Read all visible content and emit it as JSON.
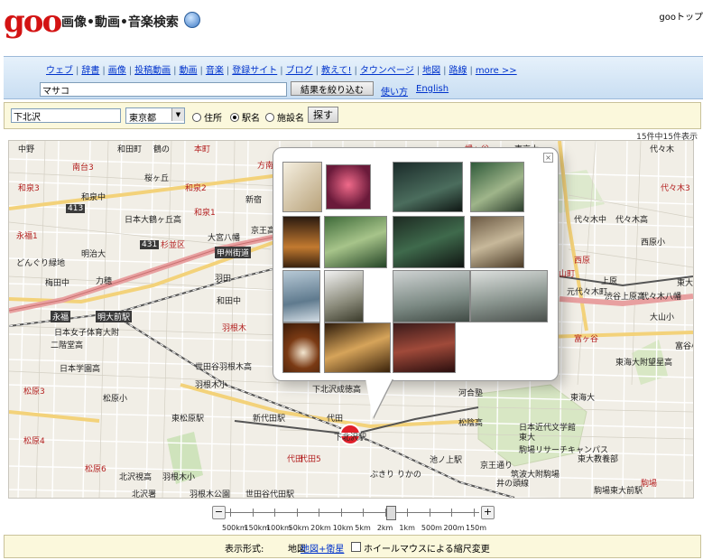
{
  "header": {
    "logo": "goo",
    "site_name": "画像•動画•音楽検索",
    "top_link": "gooトップ"
  },
  "search": {
    "tabs": [
      "ウェブ",
      "辞書",
      "画像",
      "投稿動画",
      "動画",
      "音楽",
      "登録サイト",
      "ブログ",
      "教えて!",
      "タウンページ",
      "地図",
      "路線",
      "more >>"
    ],
    "query": "マサコ",
    "narrow_button": "結果を絞り込む",
    "help_link": "使い方",
    "english_link": "English"
  },
  "station_search": {
    "keyword": "下北沢",
    "prefecture": "東京都",
    "options": [
      "住所",
      "駅名",
      "施設名"
    ],
    "selected_option": "駅名",
    "find_button": "探す"
  },
  "result_count": "15件中15件表示",
  "map": {
    "labels": [
      {
        "t": "中野",
        "c": ""
      },
      {
        "t": "和田町",
        "c": ""
      },
      {
        "t": "鶴の",
        "c": ""
      },
      {
        "t": "方南",
        "c": "red"
      },
      {
        "t": "本町",
        "c": "red"
      },
      {
        "t": "幡ヶ谷",
        "c": "red"
      },
      {
        "t": "本町1",
        "c": "red"
      },
      {
        "t": "南台2",
        "c": "red"
      },
      {
        "t": "和泉3",
        "c": "red"
      },
      {
        "t": "南台3",
        "c": "red"
      },
      {
        "t": "和泉2",
        "c": "red"
      },
      {
        "t": "新宿",
        "c": ""
      },
      {
        "t": "和泉中",
        "c": ""
      },
      {
        "t": "和泉熊野",
        "c": ""
      },
      {
        "t": "日本大鶴ヶ丘高",
        "c": ""
      },
      {
        "t": "和泉1",
        "c": "red"
      },
      {
        "t": "杉並区",
        "c": "red"
      },
      {
        "t": "大宮八幡",
        "c": ""
      },
      {
        "t": "永福1",
        "c": "red"
      },
      {
        "t": "明治大",
        "c": ""
      },
      {
        "t": "どんぐり緑地",
        "c": ""
      },
      {
        "t": "力穂",
        "c": ""
      },
      {
        "t": "甲州街道",
        "c": "rail"
      },
      {
        "t": "京王線",
        "c": ""
      },
      {
        "t": "羽田",
        "c": ""
      },
      {
        "t": "和田中",
        "c": ""
      },
      {
        "t": "梅田中",
        "c": ""
      },
      {
        "t": "京王高",
        "c": ""
      },
      {
        "t": "永福",
        "c": "rail"
      },
      {
        "t": "明大前駅",
        "c": "rail"
      },
      {
        "t": "日本女子体育大附",
        "c": ""
      },
      {
        "t": "二階堂高",
        "c": ""
      },
      {
        "t": "日本学園高",
        "c": ""
      },
      {
        "t": "羽根木",
        "c": "red"
      },
      {
        "t": "世田谷羽根木高",
        "c": ""
      },
      {
        "t": "羽根木小",
        "c": ""
      },
      {
        "t": "松原3",
        "c": "red"
      },
      {
        "t": "松原小",
        "c": ""
      },
      {
        "t": "東松原駅",
        "c": ""
      },
      {
        "t": "新代田駅",
        "c": ""
      },
      {
        "t": "下北沢成徳高",
        "c": ""
      },
      {
        "t": "代田",
        "c": ""
      },
      {
        "t": "下北沢駅",
        "c": ""
      },
      {
        "t": "松原4",
        "c": "red"
      },
      {
        "t": "代田5",
        "c": "red"
      },
      {
        "t": "松原6",
        "c": "red"
      },
      {
        "t": "北沢視高",
        "c": ""
      },
      {
        "t": "羽根木公園",
        "c": ""
      },
      {
        "t": "北沢署",
        "c": ""
      },
      {
        "t": "世田谷代田駅",
        "c": ""
      },
      {
        "t": "池ノ上駅",
        "c": ""
      },
      {
        "t": "ぶきり りかの",
        "c": ""
      },
      {
        "t": "羽根木小",
        "c": ""
      },
      {
        "t": "筑波大附駒場",
        "c": ""
      },
      {
        "t": "京王通り",
        "c": ""
      },
      {
        "t": "井の頭線",
        "c": ""
      },
      {
        "t": "駒場東大前駅",
        "c": ""
      },
      {
        "t": "東大教養部",
        "c": ""
      },
      {
        "t": "駒場",
        "c": "red"
      },
      {
        "t": "東大",
        "c": ""
      },
      {
        "t": "駒場リサーチキャンパス",
        "c": ""
      },
      {
        "t": "日本近代文学館",
        "c": ""
      },
      {
        "t": "松陰高",
        "c": ""
      },
      {
        "t": "河合塾",
        "c": ""
      },
      {
        "t": "東海大",
        "c": ""
      },
      {
        "t": "東海大附望星高",
        "c": ""
      },
      {
        "t": "富ヶ谷",
        "c": "red"
      },
      {
        "t": "元代々木町",
        "c": ""
      },
      {
        "t": "大山町",
        "c": "red"
      },
      {
        "t": "代々木八幡",
        "c": ""
      },
      {
        "t": "渋谷上原高",
        "c": ""
      },
      {
        "t": "上原",
        "c": ""
      },
      {
        "t": "代々木中",
        "c": ""
      },
      {
        "t": "代々木高",
        "c": ""
      },
      {
        "t": "西原",
        "c": "red"
      },
      {
        "t": "西原小",
        "c": ""
      },
      {
        "t": "大山小",
        "c": ""
      },
      {
        "t": "富谷小",
        "c": ""
      },
      {
        "t": "東大",
        "c": ""
      },
      {
        "t": "代々木3",
        "c": "red"
      },
      {
        "t": "代々木",
        "c": ""
      },
      {
        "t": "東京大",
        "c": ""
      },
      {
        "t": "富谷",
        "c": ""
      },
      {
        "t": "松原中",
        "c": ""
      },
      {
        "t": "413",
        "c": "rail"
      },
      {
        "t": "431",
        "c": "rail"
      },
      {
        "t": "代田",
        "c": "red"
      },
      {
        "t": "桜ヶ丘",
        "c": ""
      }
    ]
  },
  "zoom": {
    "minus": "−",
    "plus": "+",
    "scales": [
      "500km",
      "150km",
      "100km",
      "50km",
      "20km",
      "10km",
      "5km",
      "2km",
      "1km",
      "500m",
      "200m",
      "150m"
    ],
    "level_fraction": 0.66
  },
  "footer": {
    "label": "表示形式:",
    "map": "地図",
    "map_sat": "地図+衛星",
    "wheel": "ホイールマウスによる縮尺変更"
  },
  "colors": {
    "accent": "#d31313",
    "link": "#0033cc",
    "map_bg": "#f1eee6",
    "rail": "#3a3a3a"
  }
}
